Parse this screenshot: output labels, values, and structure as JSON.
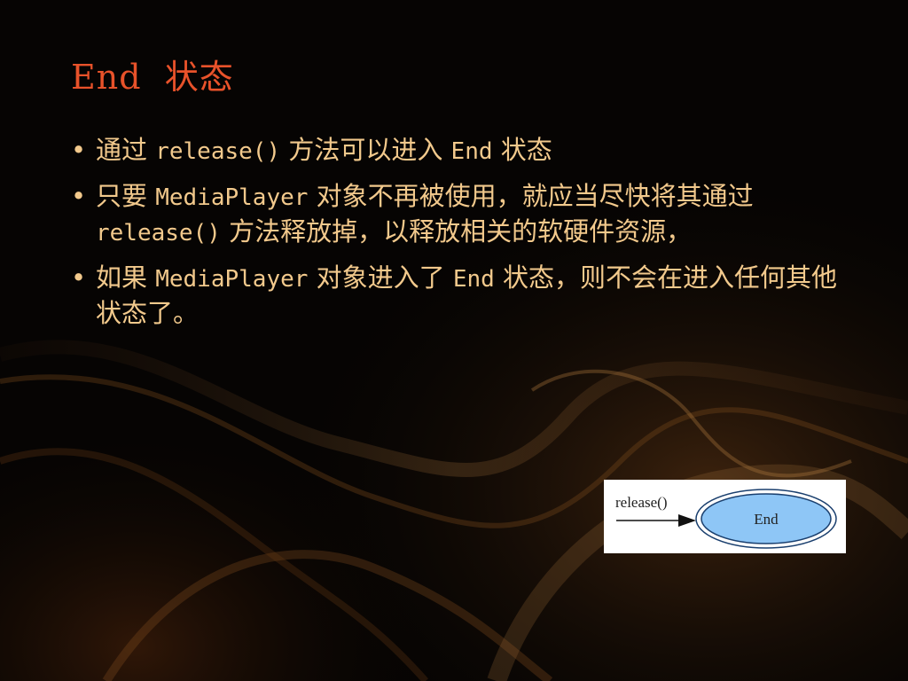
{
  "slide": {
    "title": "End  状态",
    "bullets": [
      [
        {
          "t": "通过 ",
          "mono": false
        },
        {
          "t": "release()",
          "mono": true
        },
        {
          "t": " 方法可以进入 ",
          "mono": false
        },
        {
          "t": "End",
          "mono": true
        },
        {
          "t": " 状态",
          "mono": false
        }
      ],
      [
        {
          "t": "只要 ",
          "mono": false
        },
        {
          "t": "MediaPlayer",
          "mono": true
        },
        {
          "t": " 对象不再被使用，就应当尽快将其通过 ",
          "mono": false
        },
        {
          "t": "release()",
          "mono": true
        },
        {
          "t": " 方法释放掉，以释放相关的软硬件资源，",
          "mono": false
        }
      ],
      [
        {
          "t": "如果 ",
          "mono": false
        },
        {
          "t": "MediaPlayer",
          "mono": true
        },
        {
          "t": " 对象进入了 ",
          "mono": false
        },
        {
          "t": "End",
          "mono": true
        },
        {
          "t": " 状态，则不会在进入任何其他状态了。",
          "mono": false
        }
      ]
    ]
  },
  "diagram": {
    "transition_label": "release()",
    "state_label": "End",
    "colors": {
      "state_fill": "#8ec6f6",
      "state_stroke": "#1a3f6e",
      "arrow": "#111111"
    }
  },
  "theme": {
    "title_color": "#e8522a",
    "text_color": "#f2c98c"
  }
}
